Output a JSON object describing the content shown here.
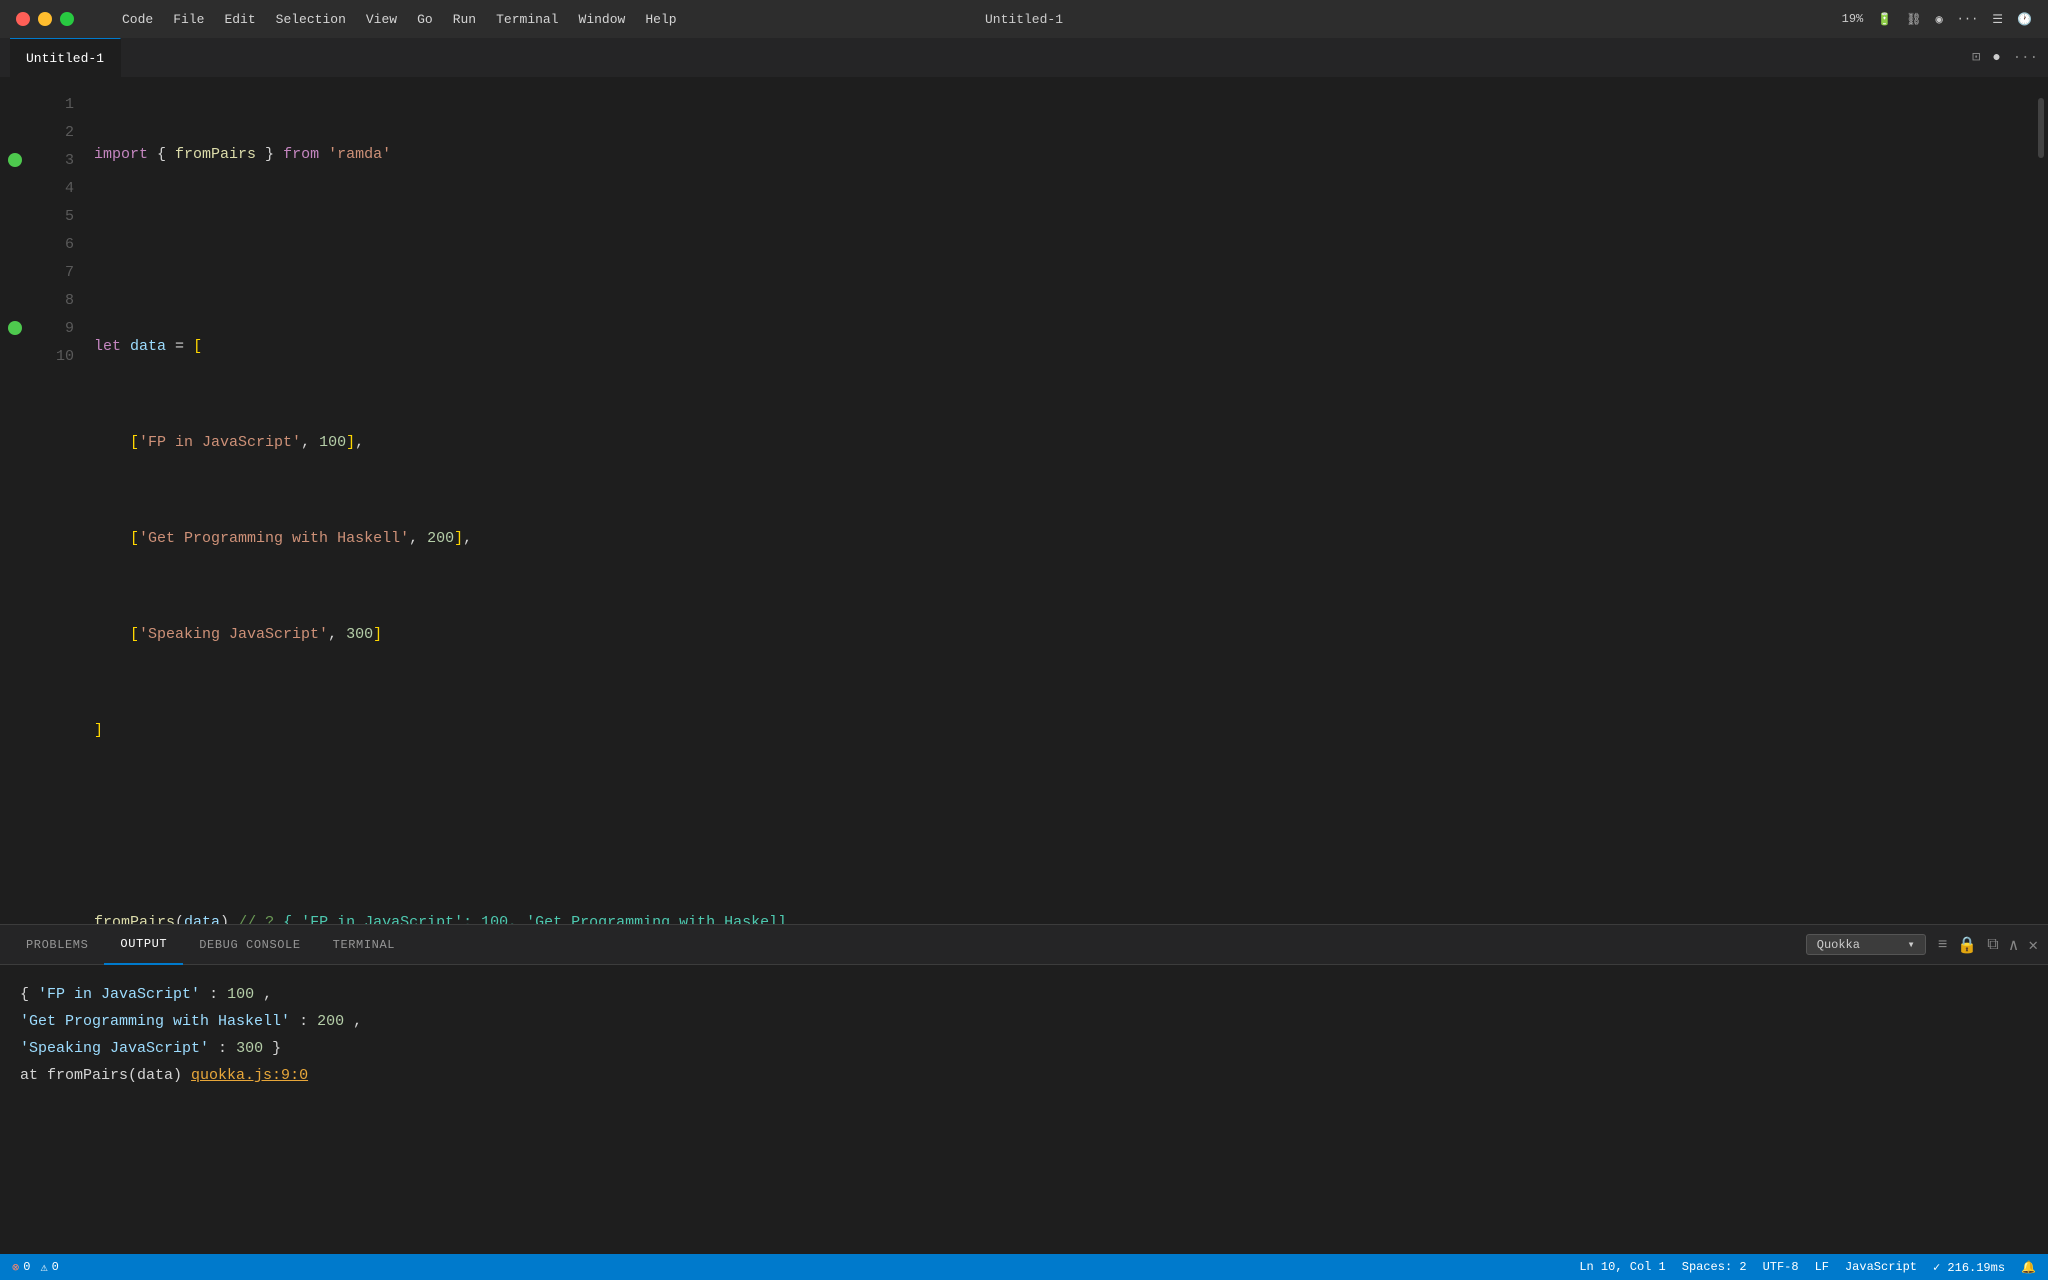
{
  "titlebar": {
    "title": "Untitled-1",
    "menu_items": [
      "Code",
      "File",
      "Edit",
      "Selection",
      "View",
      "Go",
      "Run",
      "Terminal",
      "Window",
      "Help"
    ],
    "right_items": [
      "19%",
      "⌛",
      "⛓",
      "◎",
      "···",
      "☰",
      "🕐"
    ]
  },
  "tab": {
    "label": "Untitled-1"
  },
  "editor": {
    "lines": [
      {
        "num": 1,
        "gutter": false
      },
      {
        "num": 2,
        "gutter": false
      },
      {
        "num": 3,
        "gutter": true
      },
      {
        "num": 4,
        "gutter": false
      },
      {
        "num": 5,
        "gutter": false
      },
      {
        "num": 6,
        "gutter": false
      },
      {
        "num": 7,
        "gutter": false
      },
      {
        "num": 8,
        "gutter": false
      },
      {
        "num": 9,
        "gutter": true
      },
      {
        "num": 10,
        "gutter": false
      }
    ]
  },
  "panel": {
    "tabs": [
      "PROBLEMS",
      "OUTPUT",
      "DEBUG CONSOLE",
      "TERMINAL"
    ],
    "active_tab": "OUTPUT",
    "dropdown_label": "Quokka",
    "output_lines": [
      "{ 'FP in JavaScript': 100,",
      "  'Get Programming with Haskell': 200,",
      "  'Speaking JavaScript': 300 }",
      "  at fromPairs(data) quokka.js:9:0"
    ]
  },
  "statusbar": {
    "errors": "0",
    "warnings": "0",
    "position": "Ln 10, Col 1",
    "spaces": "Spaces: 2",
    "encoding": "UTF-8",
    "line_ending": "LF",
    "language": "JavaScript",
    "timing": "✓ 216.19ms",
    "bell": "🔔"
  }
}
